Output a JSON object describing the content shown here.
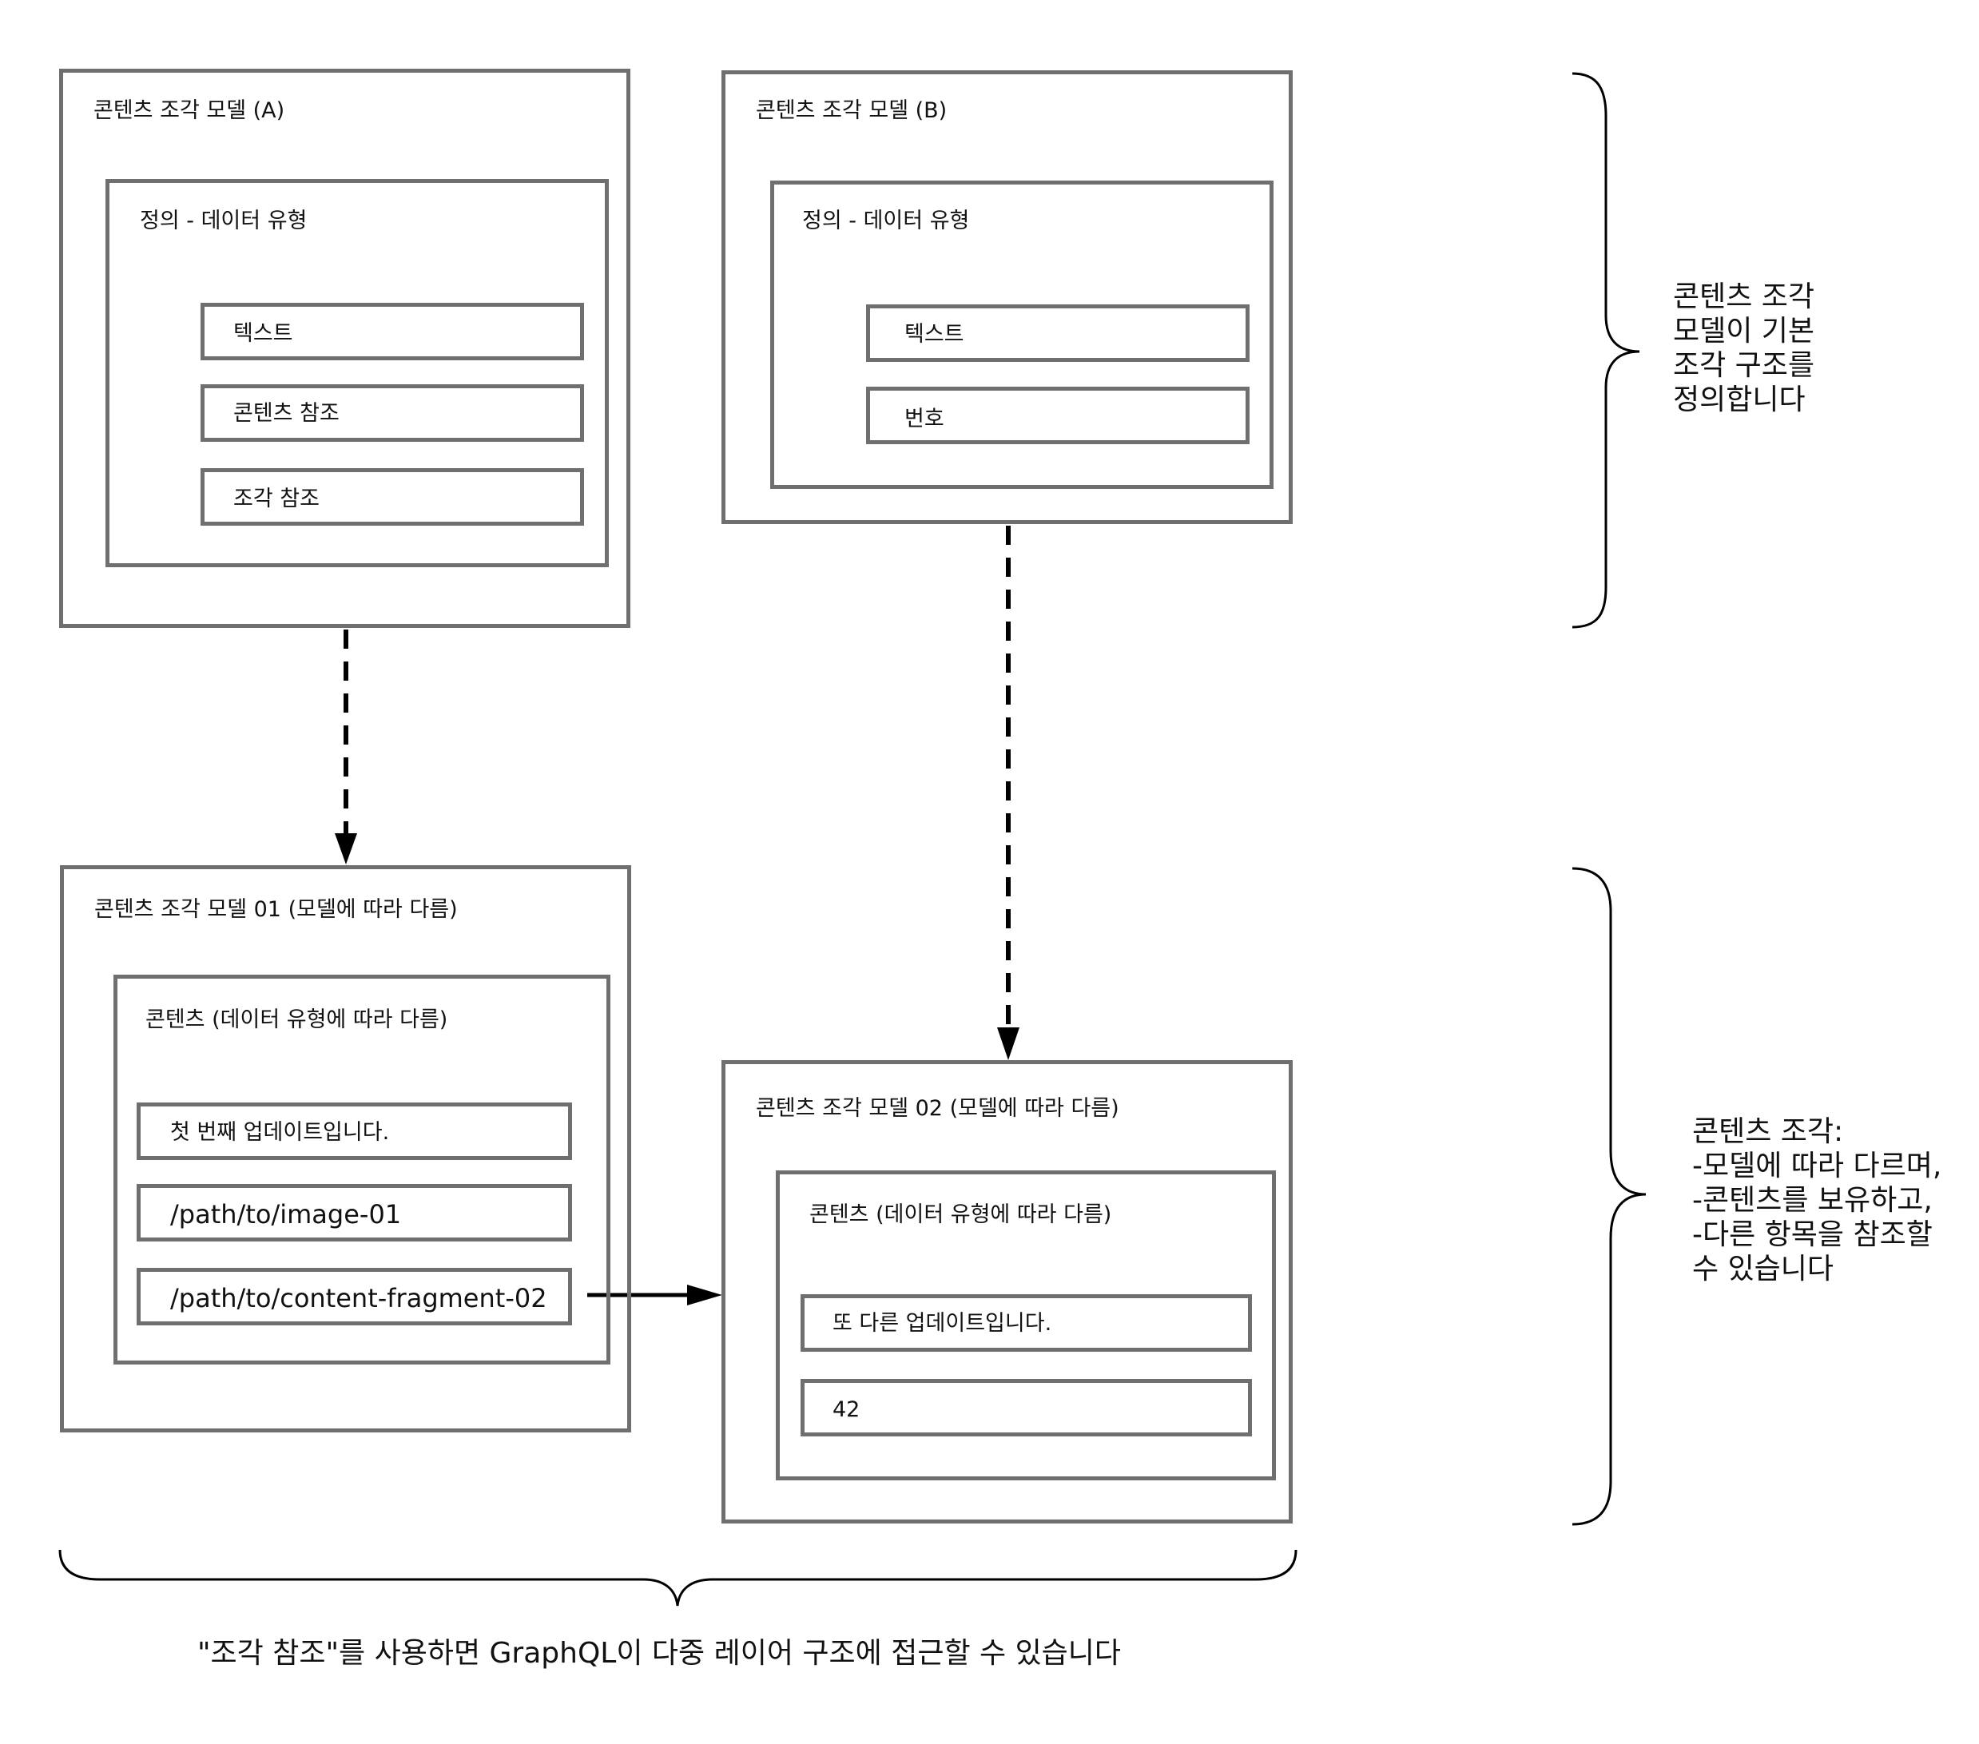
{
  "model_a": {
    "title": "콘텐츠 조각 모델 (A)",
    "definition_title": "정의 - 데이터 유형",
    "fields": [
      "텍스트",
      "콘텐츠 참조",
      "조각 참조"
    ]
  },
  "model_b": {
    "title": "콘텐츠 조각 모델 (B)",
    "definition_title": "정의 - 데이터 유형",
    "fields": [
      "텍스트",
      "번호"
    ]
  },
  "fragment_01": {
    "title": "콘텐츠 조각 모델 01 (모델에 따라 다름)",
    "content_title": "콘텐츠 (데이터 유형에 따라 다름)",
    "values": [
      "첫 번째 업데이트입니다.",
      "/path/to/image-01",
      "/path/to/content-fragment-02"
    ]
  },
  "fragment_02": {
    "title": "콘텐츠 조각 모델 02 (모델에 따라 다름)",
    "content_title": "콘텐츠 (데이터 유형에 따라 다름)",
    "values": [
      "또 다른 업데이트입니다.",
      "42"
    ]
  },
  "notes": {
    "top_right": [
      "콘텐츠 조각",
      "모델이 기본",
      "조각 구조를",
      "정의합니다"
    ],
    "bottom_right": [
      "콘텐츠 조각:",
      "-모델에 따라 다르며,",
      "-콘텐츠를 보유하고,",
      "-다른 항목을 참조할",
      "수 있습니다"
    ]
  },
  "caption": "\"조각 참조\"를 사용하면 GraphQL이 다중 레이어 구조에 접근할 수 있습니다"
}
